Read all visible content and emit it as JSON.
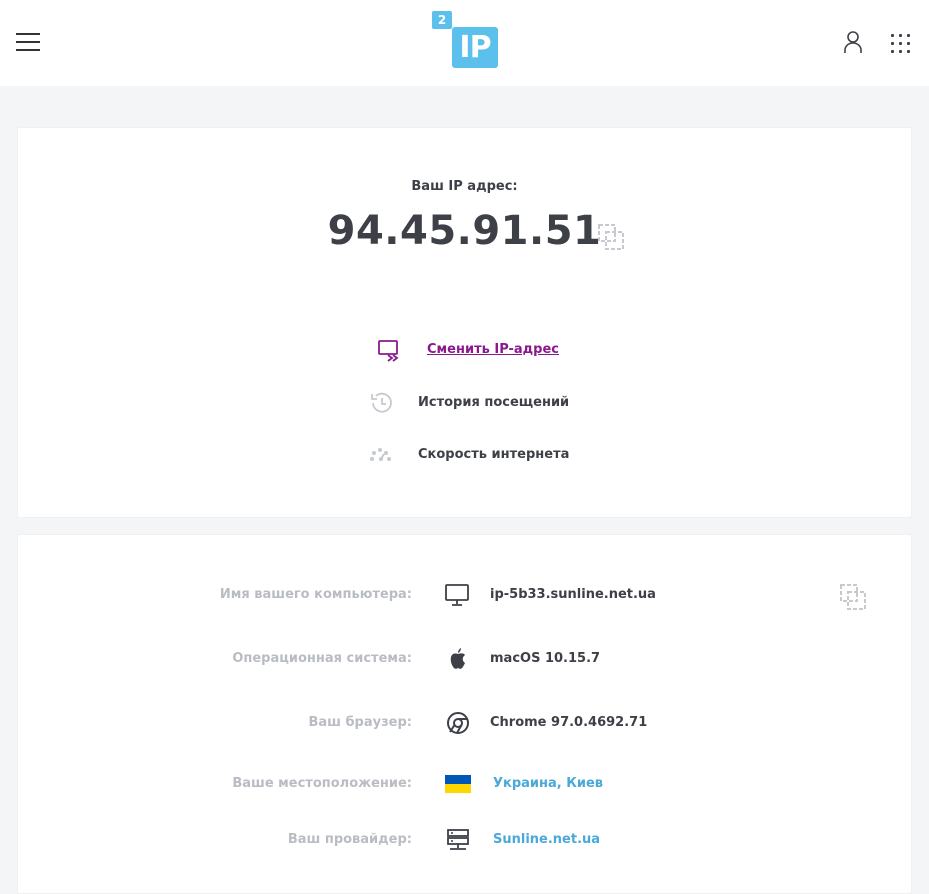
{
  "header": {
    "logo_small": "2",
    "logo_big": "IP"
  },
  "main": {
    "ip_label": "Ваш IP адрес:",
    "ip_value": "94.45.91.51",
    "actions": [
      {
        "label": "Сменить IP-адрес",
        "icon": "change-ip-icon",
        "color": "#8a1a8c"
      },
      {
        "label": "История посещений",
        "icon": "history-icon"
      },
      {
        "label": "Скорость интернета",
        "icon": "speedometer-icon"
      }
    ]
  },
  "info": {
    "rows": [
      {
        "label": "Имя вашего компьютера:",
        "value": "ip-5b33.sunline.net.ua",
        "icon": "monitor-icon"
      },
      {
        "label": "Операционная система:",
        "value": "macOS 10.15.7",
        "icon": "apple-icon"
      },
      {
        "label": "Ваш браузер:",
        "value": "Chrome 97.0.4692.71",
        "icon": "chrome-icon"
      },
      {
        "label": "Ваше местоположение:",
        "value": "Украина, Киев",
        "icon": "ukraine-flag-icon"
      },
      {
        "label": "Ваш провайдер:",
        "value": "Sunline.net.ua",
        "icon": "server-icon"
      }
    ]
  },
  "colors": {
    "accent": "#5bc0eb",
    "link": "#4aa9d9",
    "action_link": "#8a1a8c",
    "muted_label": "#b9bdc3",
    "text": "#3d4047"
  }
}
